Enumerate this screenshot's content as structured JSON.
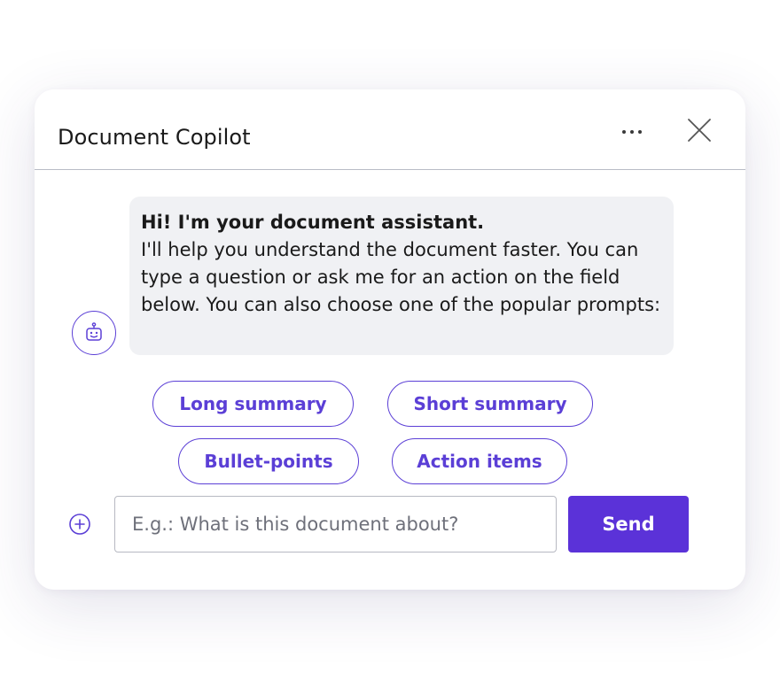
{
  "window": {
    "title": "Document Copilot",
    "more_icon": "more-horizontal-icon",
    "close_icon": "close-icon"
  },
  "message": {
    "avatar_icon": "robot-icon",
    "heading": "Hi! I'm your document assistant.",
    "body": "I'll help you understand the document faster.  You can type a question or ask me for an action on the field below.  You can also choose one of the popular prompts:"
  },
  "prompts": [
    {
      "label": "Long summary"
    },
    {
      "label": "Short summary"
    },
    {
      "label": "Bullet-points"
    },
    {
      "label": "Action items"
    }
  ],
  "composer": {
    "add_icon": "plus-circle-icon",
    "input_value": "",
    "placeholder": "E.g.: What is this document about?",
    "send_label": "Send"
  },
  "colors": {
    "accent": "#5b32d8",
    "chip_text": "#5b3fd6",
    "bubble_bg": "#f0f1f4",
    "divider": "#b9bcc6"
  }
}
